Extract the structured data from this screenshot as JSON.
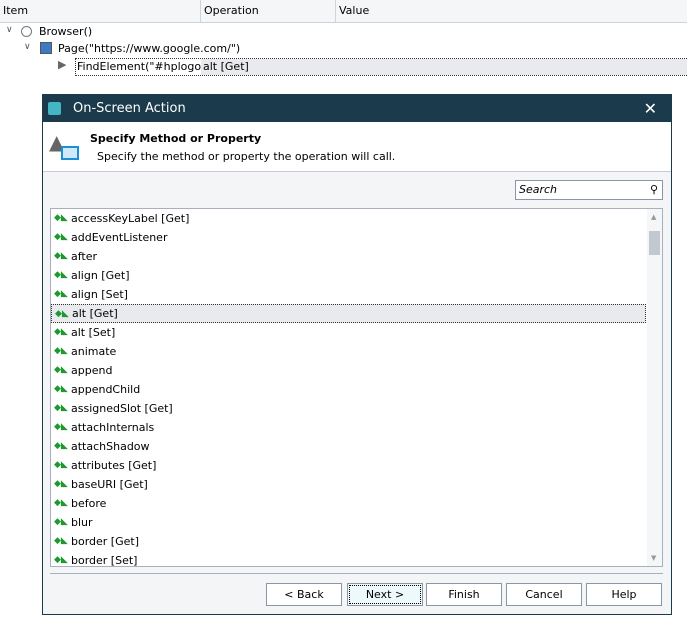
{
  "tree": {
    "columns": [
      "Item",
      "Operation",
      "Value"
    ],
    "rows": [
      {
        "item": "Browser()",
        "icon": "globe-icon"
      },
      {
        "item": "Page(\"https://www.google.com/\")",
        "icon": "web-page-icon"
      },
      {
        "item": "FindElement(\"#hplogo\")",
        "operation": "alt [Get]",
        "icon": "on-screen-action-icon"
      }
    ]
  },
  "dialog": {
    "title": "On-Screen Action",
    "close": "✕",
    "heading": "Specify Method or Property",
    "description": "Specify the method or property the operation will call.",
    "search_placeholder": "Search",
    "items": [
      "accessKeyLabel [Get]",
      "addEventListener",
      "after",
      "align [Get]",
      "align [Set]",
      "alt [Get]",
      "alt [Set]",
      "animate",
      "append",
      "appendChild",
      "assignedSlot [Get]",
      "attachInternals",
      "attachShadow",
      "attributes [Get]",
      "baseURI [Get]",
      "before",
      "blur",
      "border [Get]",
      "border [Set]"
    ],
    "selected": "alt [Get]",
    "buttons": {
      "back": "< Back",
      "next": "Next >",
      "finish": "Finish",
      "cancel": "Cancel",
      "help": "Help"
    }
  },
  "colors": {
    "titlebar": "#1b3a4b",
    "method_icon": "#1d9a2e"
  }
}
